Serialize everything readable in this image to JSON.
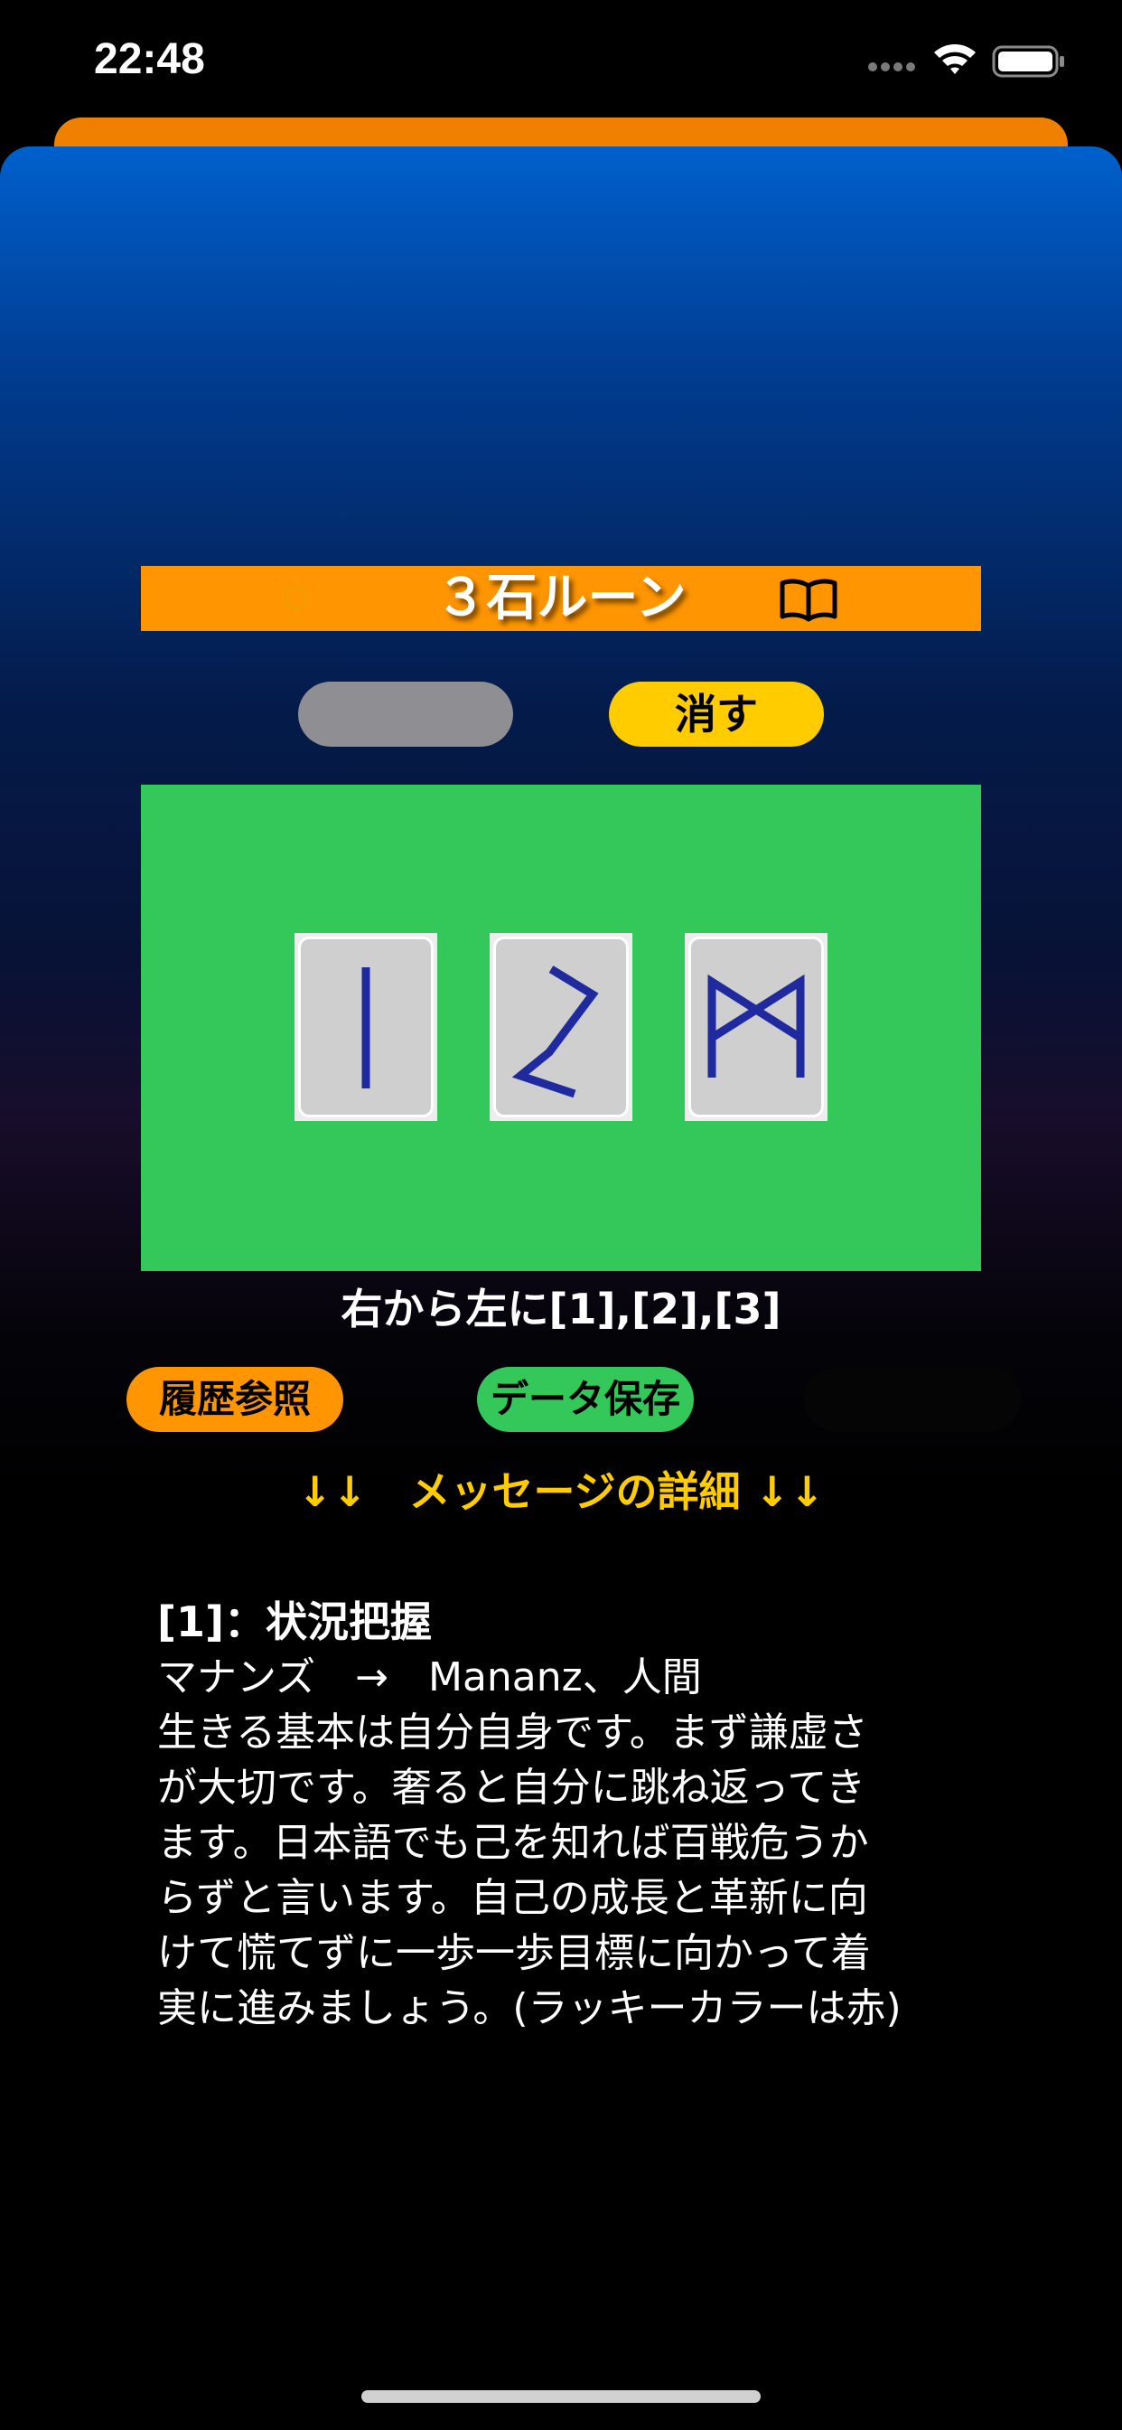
{
  "status_bar": {
    "time": "22:48"
  },
  "card": {
    "title": "３石ルーン"
  },
  "buttons": {
    "left_empty": "",
    "erase": "消す",
    "history": "履歴参照",
    "save": "データ保存",
    "hidden": ""
  },
  "runes": [
    {
      "icon": "isa-rune-icon"
    },
    {
      "icon": "perthro-rune-icon"
    },
    {
      "icon": "mannaz-rune-icon"
    }
  ],
  "order_label": "右から左に[1],[2],[3]",
  "details_header": "↓↓　メッセージの詳細 ↓↓",
  "message": {
    "title": "[1]：状況把握",
    "subtitle": "マナンズ　→　Mananz、人間",
    "lines": [
      " 生きる基本は自分自身です。まず謙虚さ",
      "が大切です。奢ると自分に跳ね返ってき",
      "ます。日本語でも己を知れば百戦危うか",
      "らずと言います。自己の成長と革新に向",
      "けて慌てずに一歩一歩目標に向かって着",
      "実に進みましょう。(ラッキーカラーは赤)"
    ]
  },
  "colors": {
    "accent_orange": "#ff9500",
    "erase_yellow": "#ffcc00",
    "board_green": "#34c759",
    "rune_blue": "#1f2a9e",
    "close_red": "#e63b3b"
  }
}
